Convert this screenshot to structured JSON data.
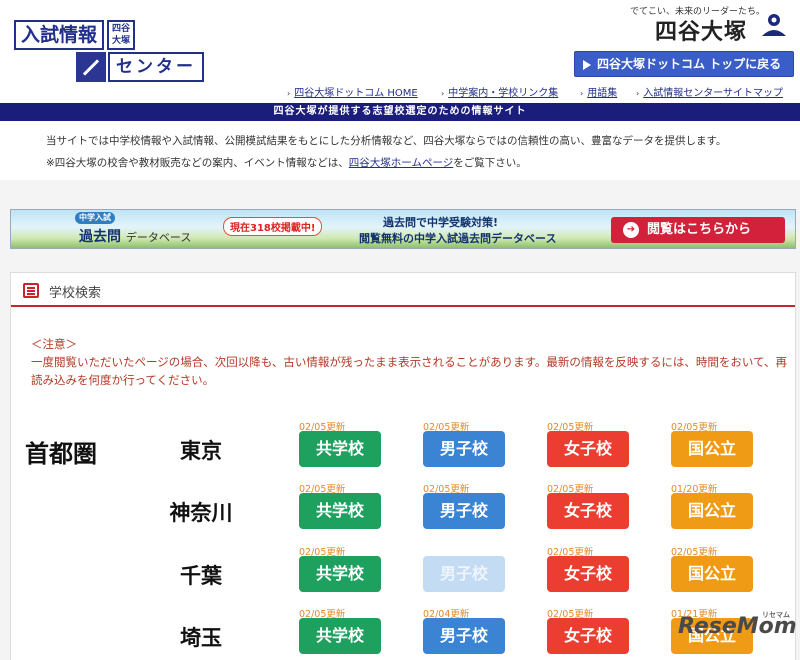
{
  "logo": {
    "line1": "入試情報",
    "badge": "四谷大塚",
    "line2": "センター"
  },
  "brand": {
    "tagline": "でてこい、未来のリーダーたち。",
    "name": "四谷大塚"
  },
  "top_button": "四谷大塚ドットコム トップに戻る",
  "top_links": [
    "四谷大塚ドットコム HOME",
    "中学案内・学校リンク集",
    "用語集",
    "入試情報センターサイトマップ"
  ],
  "banner": "四谷大塚が提供する志望校選定のための情報サイト",
  "intro": {
    "line1": "当サイトでは中学校情報や入試情報、公開模試結果をもとにした分析情報など、四谷大塚ならではの信頼性の高い、豊富なデータを提供します。",
    "line2_before": "※四谷大塚の校舎や教材販売などの案内、イベント情報などは、",
    "line2_link": "四谷大塚ホームページ",
    "line2_after": "をご覧下さい。"
  },
  "db_banner": {
    "label": "中学入試",
    "name": "過去問",
    "suffix": "データベース",
    "count": "現在318校掲載中!",
    "copy1": "過去問で中学受験対策!",
    "copy2": "閲覧無料の中学入試過去問データベース",
    "button": "閲覧はこちらから"
  },
  "search": {
    "title": "学校検索",
    "notice_head": "＜注意＞",
    "notice_body": "一度閲覧いただいたページの場合、次回以降も、古い情報が残ったまま表示されることがあります。最新の情報を反映するには、時間をおいて、再読み込みを何度か行ってください。",
    "region": "首都圏",
    "rows": [
      {
        "pref": "東京",
        "buttons": [
          {
            "label": "共学校",
            "updated": "02/05更新",
            "color": "#1ea05f"
          },
          {
            "label": "男子校",
            "updated": "02/05更新",
            "color": "#3a84d3"
          },
          {
            "label": "女子校",
            "updated": "02/05更新",
            "color": "#ec3d31"
          },
          {
            "label": "国公立",
            "updated": "02/05更新",
            "color": "#ef9b16"
          }
        ]
      },
      {
        "pref": "神奈川",
        "buttons": [
          {
            "label": "共学校",
            "updated": "02/05更新",
            "color": "#1ea05f"
          },
          {
            "label": "男子校",
            "updated": "02/05更新",
            "color": "#3a84d3"
          },
          {
            "label": "女子校",
            "updated": "02/05更新",
            "color": "#ec3d31"
          },
          {
            "label": "国公立",
            "updated": "01/20更新",
            "color": "#ef9b16"
          }
        ]
      },
      {
        "pref": "千葉",
        "buttons": [
          {
            "label": "共学校",
            "updated": "02/05更新",
            "color": "#1ea05f"
          },
          {
            "label": "男子校",
            "updated": "",
            "color": "#c4dcf3",
            "disabled": true
          },
          {
            "label": "女子校",
            "updated": "02/05更新",
            "color": "#ec3d31"
          },
          {
            "label": "国公立",
            "updated": "02/05更新",
            "color": "#ef9b16"
          }
        ]
      },
      {
        "pref": "埼玉",
        "buttons": [
          {
            "label": "共学校",
            "updated": "02/05更新",
            "color": "#1ea05f"
          },
          {
            "label": "男子校",
            "updated": "02/04更新",
            "color": "#3a84d3"
          },
          {
            "label": "女子校",
            "updated": "02/05更新",
            "color": "#ec3d31"
          },
          {
            "label": "国公立",
            "updated": "01/21更新",
            "color": "#ef9b16"
          }
        ]
      }
    ]
  },
  "watermark": {
    "text": "ReseMom",
    "sub": "リセマム"
  }
}
